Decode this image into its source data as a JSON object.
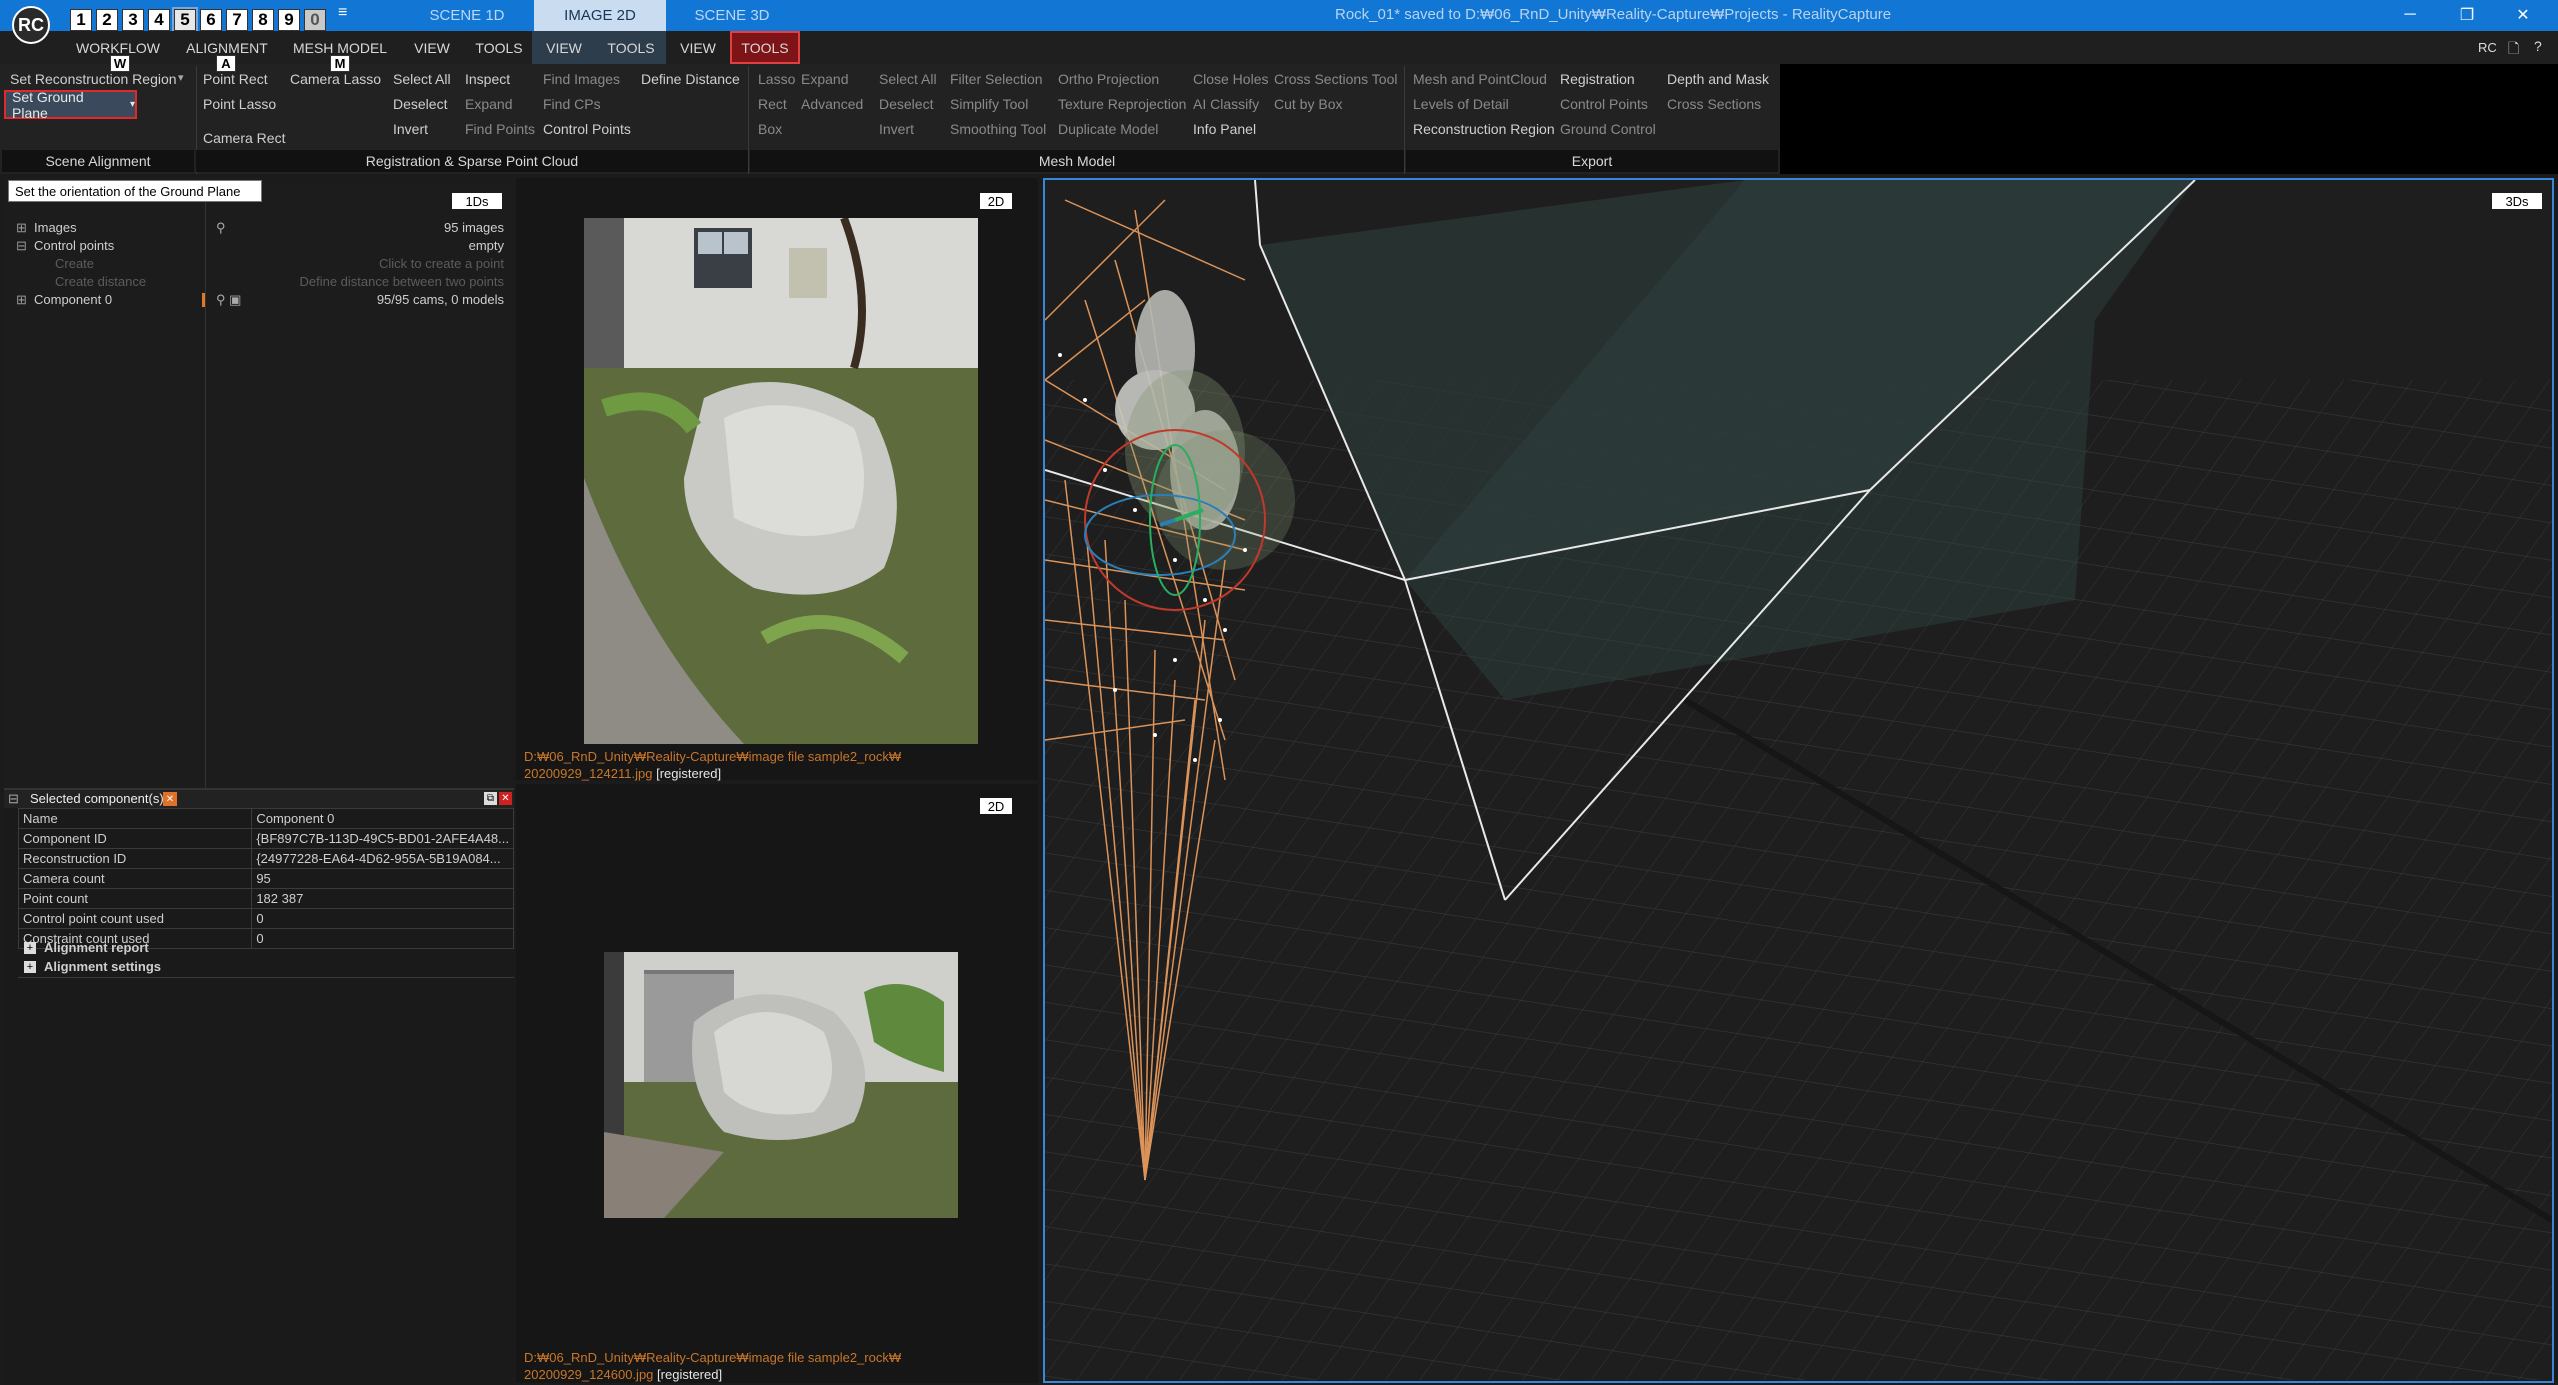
{
  "titlebar": {
    "logo": "RC",
    "layout_buttons": [
      "1",
      "2",
      "3",
      "4",
      "5",
      "6",
      "7",
      "8",
      "9",
      "0"
    ],
    "view_tabs": [
      "SCENE 1D",
      "IMAGE 2D",
      "SCENE 3D"
    ],
    "window_title": "Rock_01* saved to D:₩06_RnD_Unity₩Reality-Capture₩Projects - RealityCapture"
  },
  "menu": {
    "items": [
      "WORKFLOW",
      "ALIGNMENT",
      "MESH MODEL",
      "VIEW",
      "TOOLS",
      "VIEW",
      "TOOLS",
      "VIEW",
      "TOOLS"
    ],
    "keytips": [
      "W",
      "A",
      "M"
    ],
    "right_label": "RC"
  },
  "ribbon": {
    "scene_alignment": {
      "set_reconstruction_region": "Set Reconstruction Region",
      "set_ground_plane": "Set Ground Plane",
      "group": "Scene Alignment"
    },
    "registration": {
      "point_rect": "Point Rect",
      "camera_lasso": "Camera Lasso",
      "point_lasso": "Point Lasso",
      "camera_rect": "Camera Rect",
      "select_all": "Select All",
      "deselect": "Deselect",
      "invert": "Invert",
      "inspect": "Inspect",
      "expand": "Expand",
      "find_points": "Find Points",
      "find_images": "Find Images",
      "find_cps": "Find CPs",
      "control_points": "Control Points",
      "define_distance": "Define Distance",
      "group": "Registration & Sparse Point Cloud"
    },
    "mesh_model": {
      "lasso": "Lasso",
      "rect": "Rect",
      "box": "Box",
      "expand": "Expand",
      "advanced": "Advanced",
      "select_all": "Select All",
      "deselect": "Deselect",
      "invert": "Invert",
      "filter_selection": "Filter Selection",
      "simplify_tool": "Simplify Tool",
      "smoothing_tool": "Smoothing Tool",
      "ortho_projection": "Ortho Projection",
      "texture_reprojection": "Texture Reprojection",
      "duplicate_model": "Duplicate Model",
      "close_holes": "Close Holes",
      "ai_classify": "AI Classify",
      "info_panel": "Info Panel",
      "cross_sections_tool": "Cross Sections Tool",
      "cut_by_box": "Cut by Box",
      "group": "Mesh Model"
    },
    "export": {
      "mesh_and_pointcloud": "Mesh and PointCloud",
      "levels_of_detail": "Levels of Detail",
      "reconstruction_region": "Reconstruction Region",
      "registration": "Registration",
      "control_points": "Control Points",
      "ground_control": "Ground Control",
      "depth_and_mask": "Depth and Mask",
      "cross_sections": "Cross Sections",
      "group": "Export"
    }
  },
  "tooltip": "Set the orientation of the Ground Plane",
  "tree": {
    "badge": "1Ds",
    "images": "Images",
    "images_count": "95 images",
    "control_points": "Control points",
    "control_points_value": "empty",
    "create": "Create",
    "create_hint": "Click to create a point",
    "create_distance": "Create distance",
    "create_distance_hint": "Define distance between two points",
    "component": "Component 0",
    "component_value": "95/95 cams, 0 models"
  },
  "selected_component": {
    "title": "Selected component(s)",
    "rows": [
      {
        "k": "Name",
        "v": "Component 0"
      },
      {
        "k": "Component ID",
        "v": "{BF897C7B-113D-49C5-BD01-2AFE4A48..."
      },
      {
        "k": "Reconstruction ID",
        "v": "{24977228-EA64-4D62-955A-5B19A084..."
      },
      {
        "k": "Camera count",
        "v": "95"
      },
      {
        "k": "Point count",
        "v": "182 387"
      },
      {
        "k": "Control point count used",
        "v": "0"
      },
      {
        "k": "Constraint count used",
        "v": "0"
      }
    ],
    "alignment_report": "Alignment report",
    "alignment_settings": "Alignment settings"
  },
  "image_top": {
    "badge": "2D",
    "path": "D:₩06_RnD_Unity₩Reality-Capture₩image file sample2_rock₩",
    "file": "20200929_124211.jpg",
    "status": "[registered]"
  },
  "image_bottom": {
    "badge": "2D",
    "path": "D:₩06_RnD_Unity₩Reality-Capture₩image file sample2_rock₩",
    "file": "20200929_124600.jpg",
    "status": "[registered]"
  },
  "scene3d": {
    "badge": "3Ds"
  },
  "colors": {
    "accent": "#1176d4",
    "highlight": "#e02a2a",
    "camera_lines": "#f0a060",
    "path": "#c8762a"
  }
}
